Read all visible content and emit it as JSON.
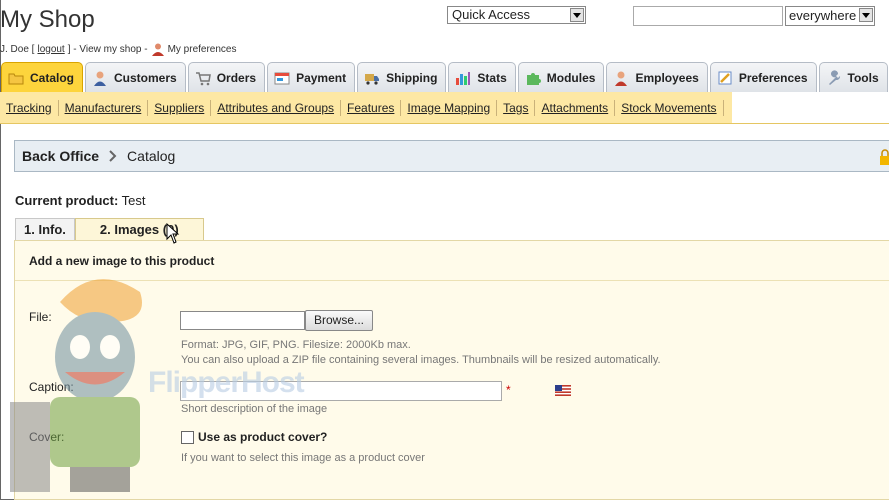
{
  "header": {
    "shop_title": "My Shop",
    "user_name": "J. Doe [",
    "logout": "logout",
    "user_sep": "] - View my shop -",
    "preferences_link": "My preferences",
    "quick_access": "Quick Access",
    "search_placeholder": "",
    "search_scope": "everywhere"
  },
  "tabs": [
    {
      "label": "Catalog",
      "icon": "folder-icon",
      "active": true
    },
    {
      "label": "Customers",
      "icon": "customer-icon"
    },
    {
      "label": "Orders",
      "icon": "cart-icon"
    },
    {
      "label": "Payment",
      "icon": "payment-icon"
    },
    {
      "label": "Shipping",
      "icon": "truck-icon"
    },
    {
      "label": "Stats",
      "icon": "chart-icon"
    },
    {
      "label": "Modules",
      "icon": "puzzle-icon"
    },
    {
      "label": "Employees",
      "icon": "employee-icon"
    },
    {
      "label": "Preferences",
      "icon": "preferences-icon"
    },
    {
      "label": "Tools",
      "icon": "wrench-icon"
    }
  ],
  "subnav": [
    "Tracking",
    "Manufacturers",
    "Suppliers",
    "Attributes and Groups",
    "Features",
    "Image Mapping",
    "Tags",
    "Attachments",
    "Stock Movements"
  ],
  "breadcrumb": {
    "root": "Back Office",
    "current": "Catalog"
  },
  "product": {
    "label": "Current product:",
    "name": "Test"
  },
  "product_tabs": [
    "1. Info.",
    "2. Images (0)"
  ],
  "form": {
    "heading": "Add a new image to this product",
    "file_label": "File:",
    "browse": "Browse...",
    "format_hint": "Format: JPG, GIF, PNG. Filesize: 2000Kb max.",
    "zip_hint": "You can also upload a ZIP file containing several images. Thumbnails will be resized automatically.",
    "caption_label": "Caption:",
    "caption_value": "",
    "required_mark": "*",
    "caption_hint": "Short description of the image",
    "cover_label": "Cover:",
    "cover_checkbox": "Use as product cover?",
    "cover_hint": "If you want to select this image as a product cover"
  },
  "watermark": "FlipperHost",
  "colors": {
    "active_tab": "#fdd43c",
    "subnav_bg": "#fde8a4",
    "panel_bg": "#fffbea",
    "breadcrumb_bg": "#e8eef3"
  }
}
